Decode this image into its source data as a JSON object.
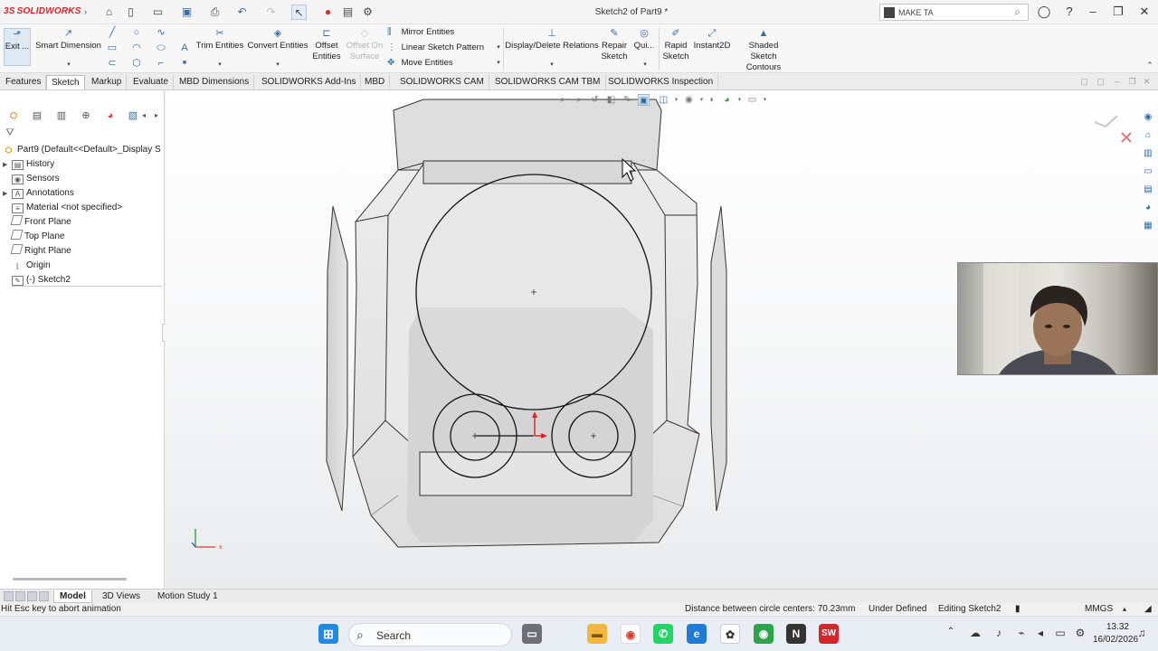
{
  "app": {
    "brand": "SOLIDWORKS",
    "brand_prefix": "3S",
    "doc_title": "Sketch2 of Part9 *",
    "search_placeholder": "MAKE TA"
  },
  "command_manager": {
    "exit_label": "Exit ...",
    "smart_dimension": "Smart Dimension",
    "trim_entities": "Trim Entities",
    "convert_entities": "Convert Entities",
    "offset_entities": [
      "Offset",
      "Entities"
    ],
    "offset_on_surface": [
      "Offset On",
      "Surface"
    ],
    "mirror_entities": "Mirror Entities",
    "linear_sketch_pattern": "Linear Sketch Pattern",
    "move_entities": "Move Entities",
    "display_delete_relations": "Display/Delete Relations",
    "repair_sketch": [
      "Repair",
      "Sketch"
    ],
    "quick_snaps": "Qui...",
    "rapid_sketch": [
      "Rapid",
      "Sketch"
    ],
    "instant2d": "Instant2D",
    "shaded_sketch_contours": [
      "Shaded Sketch",
      "Contours"
    ]
  },
  "tabs": [
    {
      "label": "Features"
    },
    {
      "label": "Sketch"
    },
    {
      "label": "Markup"
    },
    {
      "label": "Evaluate"
    },
    {
      "label": "MBD Dimensions"
    },
    {
      "label": "SOLIDWORKS Add-Ins"
    },
    {
      "label": "MBD"
    },
    {
      "label": "SOLIDWORKS CAM"
    },
    {
      "label": "SOLIDWORKS CAM TBM"
    },
    {
      "label": "SOLIDWORKS Inspection"
    }
  ],
  "active_tab": "Sketch",
  "feature_tree": {
    "root": "Part9  (Default<<Default>_Display S",
    "items": [
      {
        "label": "History"
      },
      {
        "label": "Sensors"
      },
      {
        "label": "Annotations"
      },
      {
        "label": "Material <not specified>"
      },
      {
        "label": "Front Plane"
      },
      {
        "label": "Top Plane"
      },
      {
        "label": "Right Plane"
      },
      {
        "label": "Origin"
      },
      {
        "label": "(-) Sketch2"
      }
    ]
  },
  "bottom_tabs": [
    {
      "label": "Model"
    },
    {
      "label": "3D Views"
    },
    {
      "label": "Motion Study 1"
    }
  ],
  "status": {
    "hint": "Hit Esc key to abort animation",
    "measure": "Distance between circle centers: 70.23mm",
    "definition": "Under Defined",
    "editing": "Editing Sketch2",
    "units": "MMGS"
  },
  "taskbar": {
    "search_label": "Search",
    "time": "13.32",
    "date": "16/02/2026"
  },
  "colors": {
    "brand_red": "#d5262c",
    "accent_blue": "#3a6ea5",
    "sketch_line": "#111111",
    "origin_red": "#e02020"
  }
}
